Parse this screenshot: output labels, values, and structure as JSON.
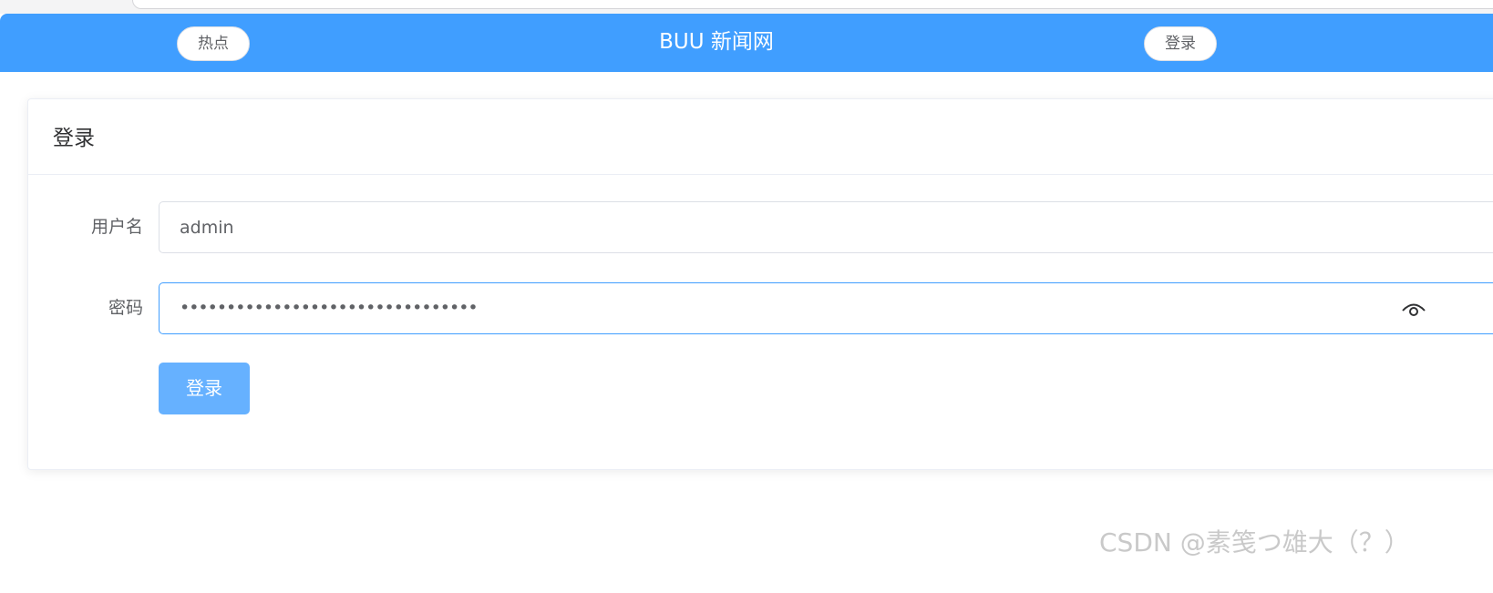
{
  "header": {
    "hot_button": "热点",
    "site_title": "BUU 新闻网",
    "login_button": "登录"
  },
  "login_card": {
    "title": "登录",
    "username_label": "用户名",
    "username_value": "admin",
    "password_label": "密码",
    "password_masked": "••••••••••••••••••••••••••••••••",
    "submit_label": "登录"
  },
  "icons": {
    "password_toggle": "eye-icon"
  },
  "colors": {
    "nav_background": "#409eff",
    "submit_button": "#66b1ff",
    "focused_border": "#409eff"
  },
  "watermark": "CSDN @素笺つ雄大（？）"
}
